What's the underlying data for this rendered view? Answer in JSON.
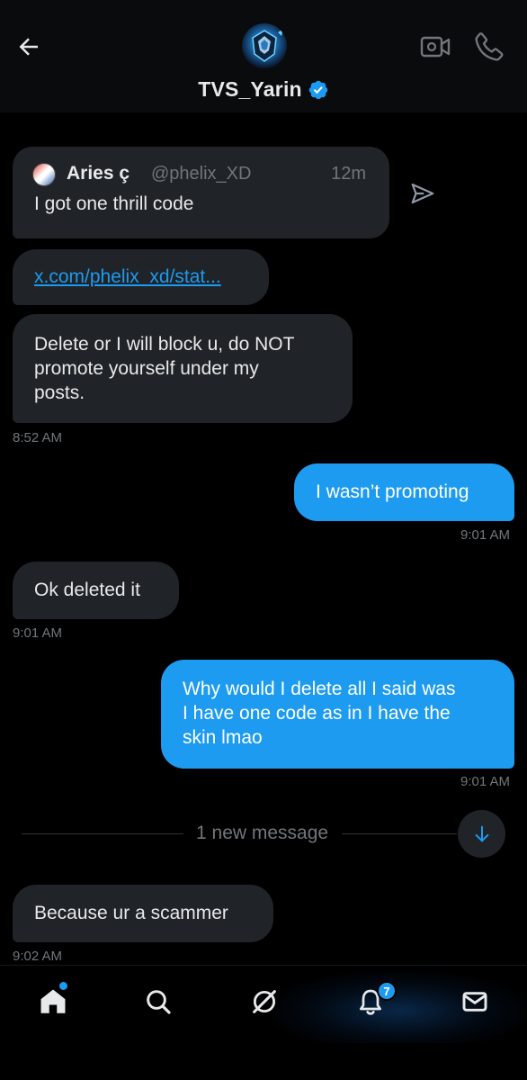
{
  "header": {
    "title": "TVS_Yarin",
    "back_icon": "arrow-left-icon",
    "video_icon": "video-camera-icon",
    "call_icon": "phone-icon",
    "verified_icon": "verified-badge-icon",
    "verified_color": "#1d9bf0"
  },
  "quote": {
    "author_name": "Aries ç",
    "author_handle": "@phelix_XD",
    "time": "12m",
    "text": "I got one thrill code",
    "share_icon": "send-icon"
  },
  "messages": [
    {
      "id": "link",
      "direction": "in",
      "text": "x.com/phelix_xd/stat...",
      "is_link": true
    },
    {
      "id": "block",
      "direction": "in",
      "lines": [
        "Delete or I will block u, do NOT",
        "promote yourself under my",
        "posts."
      ],
      "time": "8:52 AM"
    },
    {
      "id": "promoting",
      "direction": "out",
      "text": "I wasn’t promoting",
      "time": "9:01 AM"
    },
    {
      "id": "deleted",
      "direction": "in",
      "text": "Ok deleted it",
      "time": "9:01 AM"
    },
    {
      "id": "why",
      "direction": "out",
      "lines": [
        "Why would I delete all I said was",
        "I have one code as in I have the",
        "skin lmao"
      ],
      "time": "9:01 AM"
    },
    {
      "id": "scammer",
      "direction": "in",
      "text": "Because ur a scammer",
      "time": "9:02 AM"
    }
  ],
  "divider": {
    "label": "1 new message",
    "scroll_icon": "arrow-down-icon"
  },
  "bottom_nav": {
    "items": [
      "home-icon",
      "search-icon",
      "grok-icon",
      "notifications-icon",
      "mail-icon"
    ],
    "notifications_count": "7"
  },
  "colors": {
    "accent": "#1d9bf0",
    "incoming_bubble": "#202327",
    "background": "#000000",
    "muted_text": "#71767b"
  }
}
